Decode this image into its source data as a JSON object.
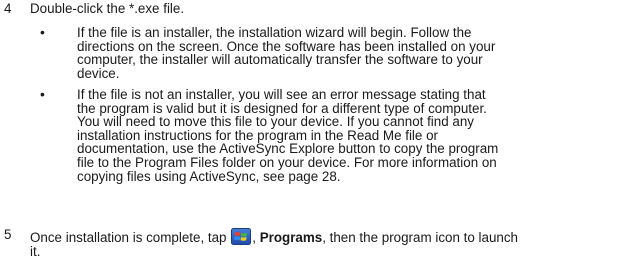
{
  "steps": [
    {
      "number": "4",
      "text": "Double-click the *.exe file."
    },
    {
      "number": "5",
      "before_icon": "Once installation is complete, tap ",
      "icon": "windows-start-icon",
      "after_icon_sep": ", ",
      "bold": "Programs",
      "after_bold": ", then the program icon to launch",
      "line2": "it."
    }
  ],
  "bullets": [
    {
      "symbol": "•",
      "lines": [
        "If the file is an installer, the installation wizard will begin. Follow the",
        "directions on the screen. Once the software has been installed on your",
        "computer, the installer will automatically transfer the software to your",
        "device."
      ]
    },
    {
      "symbol": "•",
      "lines": [
        "If the file is not an installer, you will see an error message stating that",
        "the program is valid but it is designed for a different type of computer.",
        "You will need to move this file to your device. If you cannot find any",
        "installation instructions for the program in the Read Me file or",
        "documentation, use the ActiveSync Explore button to copy the program",
        "file to the Program Files folder on your device. For more information on",
        "copying files using ActiveSync, see page 28."
      ]
    }
  ]
}
